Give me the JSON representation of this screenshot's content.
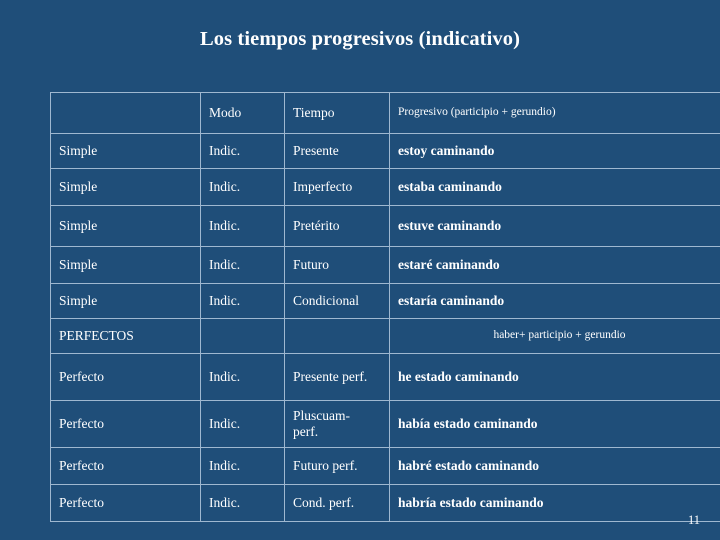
{
  "slide": {
    "title": "Los tiempos progresivos (indicativo)",
    "page_number": "11",
    "background_color": "#1f4e79",
    "accent_color": "#ffff00"
  },
  "table": {
    "headers": [
      "",
      "Modo",
      "Tiempo",
      "Progresivo (participio + gerundio)"
    ],
    "rows": [
      {
        "aspect": "Simple",
        "modo": "Indic.",
        "tiempo": "Presente",
        "progresivo": "estoy caminando"
      },
      {
        "aspect": "Simple",
        "modo": "Indic.",
        "tiempo": "Imperfecto",
        "progresivo": "estaba caminando"
      },
      {
        "aspect": "Simple",
        "modo": "Indic.",
        "tiempo": "Pretérito",
        "progresivo": "estuve caminando"
      },
      {
        "aspect": "Simple",
        "modo": "Indic.",
        "tiempo": "Futuro",
        "progresivo": "estaré caminando"
      },
      {
        "aspect": "Simple",
        "modo": "Indic.",
        "tiempo": "Condicional",
        "progresivo": "estaría caminando"
      }
    ],
    "perfectos_row": {
      "label": "PERFECTOS",
      "note": "haber+ participio + gerundio"
    },
    "perfect_rows": [
      {
        "aspect": "Perfecto",
        "modo": "Indic.",
        "tiempo": "Presente perf.",
        "progresivo": "he estado caminando"
      },
      {
        "aspect": "Perfecto",
        "modo": "Indic.",
        "tiempo": "Pluscuam-\nperf.",
        "progresivo": "había estado caminando"
      },
      {
        "aspect": "Perfecto",
        "modo": "Indic.",
        "tiempo": "Futuro perf.",
        "progresivo": "habré estado caminando"
      },
      {
        "aspect": "Perfecto",
        "modo": "Indic.",
        "tiempo": "Cond. perf.",
        "progresivo": "habría estado caminando"
      }
    ]
  }
}
